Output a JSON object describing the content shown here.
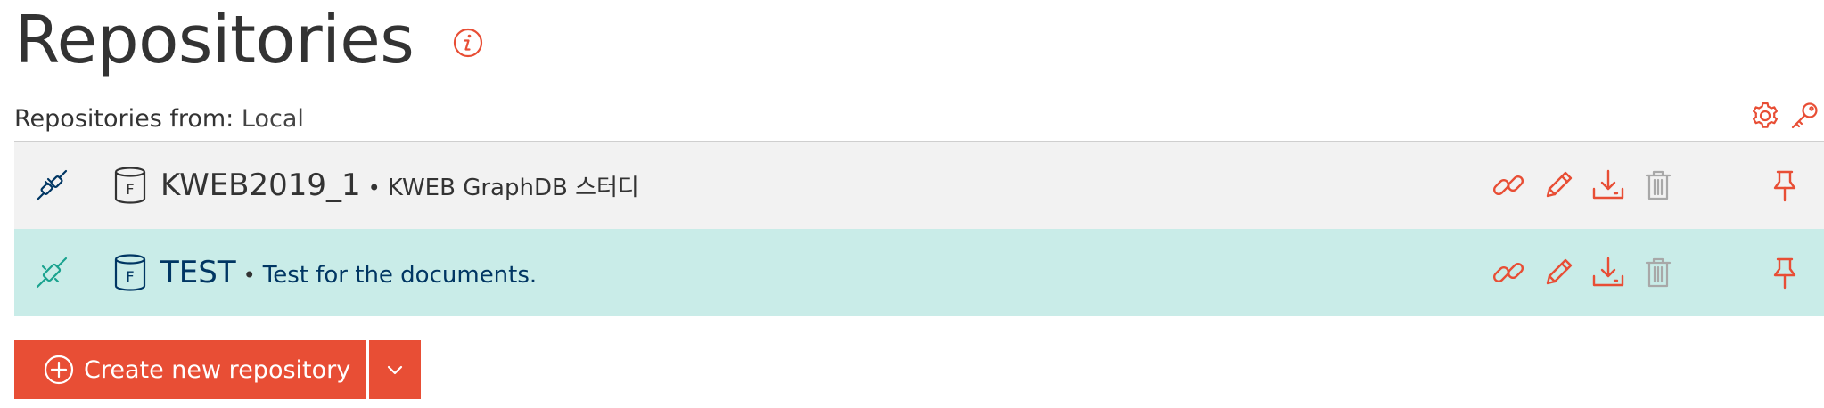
{
  "page": {
    "title": "Repositories",
    "info_icon": "info-icon"
  },
  "source": {
    "label": "Repositories from:",
    "value": "Local"
  },
  "toolbar": {
    "icons": [
      "gear-icon",
      "key-icon"
    ]
  },
  "repositories": [
    {
      "name": "KWEB2019_1",
      "separator": "•",
      "description": "KWEB GraphDB 스터디",
      "type_letter": "F",
      "connected": false,
      "actions": [
        "link-icon",
        "edit-icon",
        "download-icon",
        "trash-icon"
      ],
      "pin": "pin-icon"
    },
    {
      "name": "TEST",
      "separator": "•",
      "description": "Test for the documents.",
      "type_letter": "F",
      "connected": true,
      "actions": [
        "link-icon",
        "edit-icon",
        "download-icon",
        "trash-icon"
      ],
      "pin": "pin-icon"
    }
  ],
  "create": {
    "label": "Create new repository"
  },
  "colors": {
    "accent": "#e84e35",
    "active_row": "#c9ece8",
    "inactive_row": "#f2f2f2",
    "connected_icon": "#1aa38f",
    "disconnected_icon": "#003663",
    "trash_disabled": "#a8a8a8"
  }
}
